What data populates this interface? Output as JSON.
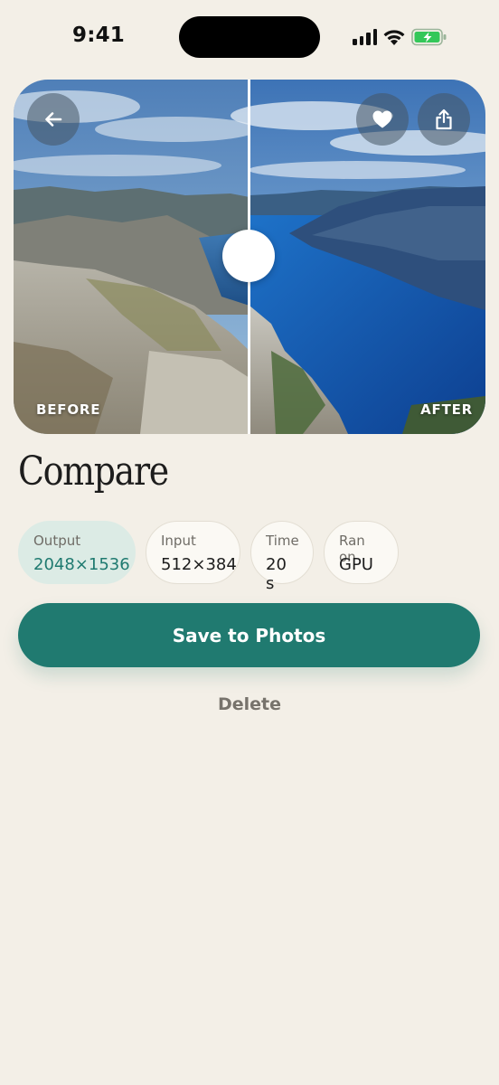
{
  "status_bar": {
    "time": "9:41",
    "icons": [
      "cellular-signal-icon",
      "wifi-icon",
      "battery-charging-icon"
    ],
    "battery_color": "#34c759"
  },
  "compare": {
    "before_label": "BEFORE",
    "after_label": "AFTER",
    "divider_position": 0.5,
    "icons": {
      "back": "arrow-left-icon",
      "favorite": "heart-icon",
      "share": "share-icon"
    }
  },
  "title": "Compare",
  "stats": [
    {
      "label": "Output",
      "value": "2048×1536",
      "highlighted": true
    },
    {
      "label": "Input",
      "value": "512×384",
      "highlighted": false
    },
    {
      "label": "Time",
      "value": "20 s",
      "highlighted": false
    },
    {
      "label": "Ran on",
      "value": "GPU",
      "highlighted": false
    }
  ],
  "actions": {
    "save_label": "Save to Photos",
    "delete_label": "Delete"
  },
  "colors": {
    "background": "#f3efe7",
    "accent": "#207a70",
    "accent_light": "#dcebe5"
  }
}
